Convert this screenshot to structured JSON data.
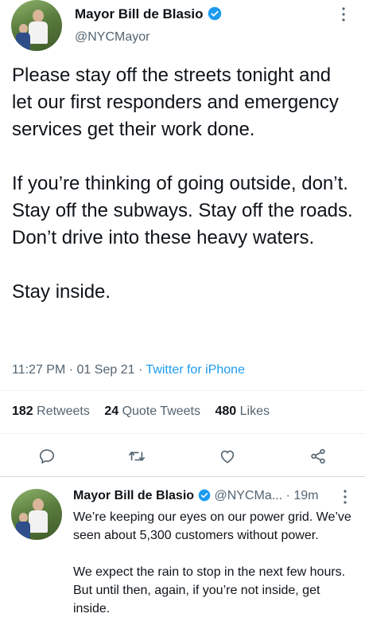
{
  "tweet": {
    "author_name": "Mayor Bill de Blasio",
    "author_handle": "@NYCMayor",
    "text": "Please stay off the streets tonight and let our first responders and emergency services get their work done.\n\nIf you’re thinking of going outside, don’t. Stay off the subways. Stay off the roads. Don’t drive into these heavy waters.\n\nStay inside.",
    "time": "11:27 PM",
    "date": "01 Sep 21",
    "separator": "·",
    "source": "Twitter for iPhone"
  },
  "stats": {
    "retweets_count": "182",
    "retweets_label": "Retweets",
    "quotes_count": "24",
    "quotes_label": "Quote Tweets",
    "likes_count": "480",
    "likes_label": "Likes"
  },
  "actions": [
    "reply-icon",
    "retweet-icon",
    "like-icon",
    "share-icon"
  ],
  "reply": {
    "author_name": "Mayor Bill de Blasio",
    "author_handle": "@NYCMa...",
    "separator": "·",
    "age": "19m",
    "text": "We’re keeping our eyes on our power grid. We’ve seen about 5,300 customers without power.\n\nWe expect the rain to stop in the next few hours. But until then, again, if you’re not inside, get inside."
  },
  "colors": {
    "text": "#0f1419",
    "secondary": "#536471",
    "accent": "#1d9bf0",
    "divider": "#eff3f4"
  }
}
